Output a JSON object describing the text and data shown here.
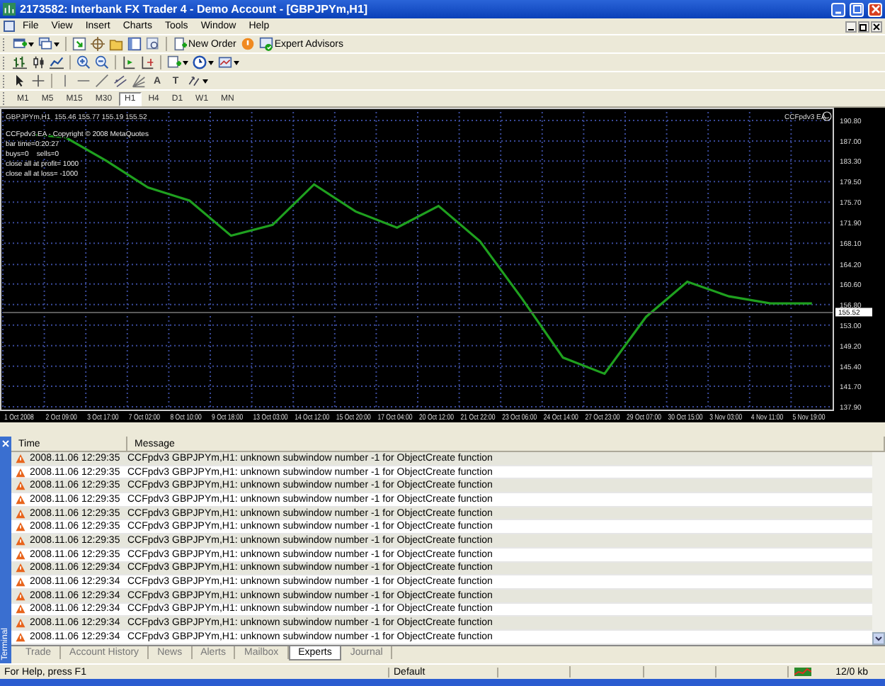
{
  "window": {
    "title": "2173582: Interbank FX Trader 4 - Demo Account - [GBPJPYm,H1]"
  },
  "menu": [
    "File",
    "View",
    "Insert",
    "Charts",
    "Tools",
    "Window",
    "Help"
  ],
  "standard_toolbar": {
    "new_order": "New Order",
    "expert_advisors": "Expert Advisors"
  },
  "line_studies_toolbar": {
    "text_tool": "A",
    "label_tool": "T"
  },
  "periods": [
    {
      "label": "M1",
      "selected": false
    },
    {
      "label": "M5",
      "selected": false
    },
    {
      "label": "M15",
      "selected": false
    },
    {
      "label": "M30",
      "selected": false
    },
    {
      "label": "H1",
      "selected": true
    },
    {
      "label": "H4",
      "selected": false
    },
    {
      "label": "D1",
      "selected": false
    },
    {
      "label": "W1",
      "selected": false
    },
    {
      "label": "MN",
      "selected": false
    }
  ],
  "chart": {
    "header": "GBPJPYm,H1  155.46 155.77 155.19 155.52",
    "ea_label": "CCFpdv3 EA",
    "comment_lines": [
      "CCFpdv3 EA - Copyright © 2008 MetaQuotes",
      "bar time=0:20:27",
      "buys=0    sells=0",
      "close all at profit= 1000",
      "close all at loss= -1000"
    ],
    "current_price": "155.52",
    "chart_data": {
      "type": "line",
      "ylim": [
        137.9,
        190.8
      ],
      "grid": true,
      "categories": [
        "1 Oct 2008",
        "2 Oct 09:00",
        "3 Oct 17:00",
        "7 Oct 02:00",
        "8 Oct 10:00",
        "9 Oct 18:00",
        "13 Oct 03:00",
        "14 Oct 12:00",
        "15 Oct 20:00",
        "17 Oct 04:00",
        "20 Oct 12:00",
        "21 Oct 22:00",
        "23 Oct 06:00",
        "24 Oct 14:00",
        "27 Oct 23:00",
        "29 Oct 07:00",
        "30 Oct 15:00",
        "3 Nov 03:00",
        "4 Nov 11:00",
        "5 Nov 19:00"
      ],
      "series": [
        {
          "color": "#1fa01f",
          "values": [
            188.3,
            187.7,
            183.3,
            178.4,
            176.0,
            169.5,
            171.5,
            179.0,
            174.0,
            171.0,
            175.0,
            168.5,
            158.0,
            147.0,
            144.0,
            154.5,
            161.0,
            158.3,
            157.0,
            157.0
          ]
        }
      ],
      "yticks": [
        {
          "value": 190.8,
          "label": "190.80"
        },
        {
          "value": 187.0,
          "label": "187.00"
        },
        {
          "value": 183.3,
          "label": "183.30"
        },
        {
          "value": 179.5,
          "label": "179.50"
        },
        {
          "value": 175.7,
          "label": "175.70"
        },
        {
          "value": 171.9,
          "label": "171.90"
        },
        {
          "value": 168.1,
          "label": "168.10"
        },
        {
          "value": 164.2,
          "label": "164.20"
        },
        {
          "value": 160.6,
          "label": "160.60"
        },
        {
          "value": 156.8,
          "label": "156.80"
        },
        {
          "value": 153.0,
          "label": "153.00"
        },
        {
          "value": 149.2,
          "label": "149.20"
        },
        {
          "value": 145.4,
          "label": "145.40"
        },
        {
          "value": 141.7,
          "label": "141.70"
        },
        {
          "value": 137.9,
          "label": "137.90"
        }
      ]
    }
  },
  "terminal": {
    "title": "Terminal",
    "columns": [
      "Time",
      "Message"
    ],
    "rows": [
      {
        "time": "2008.11.06 12:29:35",
        "message": "CCFpdv3 GBPJPYm,H1: unknown subwindow number -1 for ObjectCreate function"
      },
      {
        "time": "2008.11.06 12:29:35",
        "message": "CCFpdv3 GBPJPYm,H1: unknown subwindow number -1 for ObjectCreate function"
      },
      {
        "time": "2008.11.06 12:29:35",
        "message": "CCFpdv3 GBPJPYm,H1: unknown subwindow number -1 for ObjectCreate function"
      },
      {
        "time": "2008.11.06 12:29:35",
        "message": "CCFpdv3 GBPJPYm,H1: unknown subwindow number -1 for ObjectCreate function"
      },
      {
        "time": "2008.11.06 12:29:35",
        "message": "CCFpdv3 GBPJPYm,H1: unknown subwindow number -1 for ObjectCreate function"
      },
      {
        "time": "2008.11.06 12:29:35",
        "message": "CCFpdv3 GBPJPYm,H1: unknown subwindow number -1 for ObjectCreate function"
      },
      {
        "time": "2008.11.06 12:29:35",
        "message": "CCFpdv3 GBPJPYm,H1: unknown subwindow number -1 for ObjectCreate function"
      },
      {
        "time": "2008.11.06 12:29:35",
        "message": "CCFpdv3 GBPJPYm,H1: unknown subwindow number -1 for ObjectCreate function"
      },
      {
        "time": "2008.11.06 12:29:34",
        "message": "CCFpdv3 GBPJPYm,H1: unknown subwindow number -1 for ObjectCreate function"
      },
      {
        "time": "2008.11.06 12:29:34",
        "message": "CCFpdv3 GBPJPYm,H1: unknown subwindow number -1 for ObjectCreate function"
      },
      {
        "time": "2008.11.06 12:29:34",
        "message": "CCFpdv3 GBPJPYm,H1: unknown subwindow number -1 for ObjectCreate function"
      },
      {
        "time": "2008.11.06 12:29:34",
        "message": "CCFpdv3 GBPJPYm,H1: unknown subwindow number -1 for ObjectCreate function"
      },
      {
        "time": "2008.11.06 12:29:34",
        "message": "CCFpdv3 GBPJPYm,H1: unknown subwindow number -1 for ObjectCreate function"
      },
      {
        "time": "2008.11.06 12:29:34",
        "message": "CCFpdv3 GBPJPYm,H1: unknown subwindow number -1 for ObjectCreate function"
      }
    ],
    "tabs": [
      {
        "label": "Trade",
        "selected": false
      },
      {
        "label": "Account History",
        "selected": false
      },
      {
        "label": "News",
        "selected": false
      },
      {
        "label": "Alerts",
        "selected": false
      },
      {
        "label": "Mailbox",
        "selected": false
      },
      {
        "label": "Experts",
        "selected": true
      },
      {
        "label": "Journal",
        "selected": false
      }
    ]
  },
  "status_bar": {
    "help": "For Help, press F1",
    "profile": "Default",
    "traffic": "12/0 kb"
  }
}
